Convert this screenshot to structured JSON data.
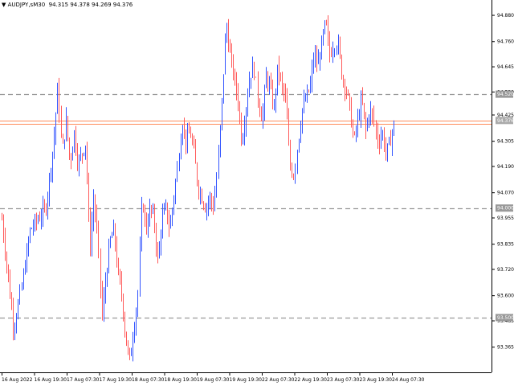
{
  "window": {
    "symbol_menu_icon": "triangle-down-icon",
    "symbol": "AUDJPY,sM30",
    "ohlc": "94.315 94.378 94.269 94.376"
  },
  "colors": {
    "background": "#ffffff",
    "bull": "#3355ff",
    "bear": "#ff5a5a",
    "level_line": "#999999",
    "bid_line": "#ff8c5a",
    "ask_line": "#ff8c5a",
    "level_badge": "#999999",
    "price_badge": "#aaaaaa"
  },
  "chart_data": {
    "type": "candlestick",
    "symbol": "AUDJPY,sM30",
    "current_price": "94.376",
    "y_range": [
      93.25,
      94.95
    ],
    "y_ticks": [
      "94.880",
      "94.760",
      "94.645",
      "94.530",
      "94.425",
      "94.305",
      "94.190",
      "94.070",
      "93.955",
      "93.835",
      "93.720",
      "93.600",
      "93.485",
      "93.365"
    ],
    "x_ticks": [
      "16 Aug 2022",
      "16 Aug 19:30",
      "17 Aug 07:30",
      "17 Aug 19:30",
      "18 Aug 07:30",
      "18 Aug 19:30",
      "19 Aug 07:30",
      "19 Aug 19:30",
      "22 Aug 07:30",
      "22 Aug 19:30",
      "23 Aug 07:30",
      "23 Aug 19:30",
      "24 Aug 07:30"
    ],
    "horizontal_levels": [
      {
        "price": 94.52,
        "label": "94.520"
      },
      {
        "price": 94.0,
        "label": "94.000"
      },
      {
        "price": 93.5,
        "label": "93.500"
      }
    ],
    "price_lines": [
      {
        "price": 94.4,
        "label": "94.376"
      },
      {
        "price": 94.383,
        "label": ""
      }
    ],
    "path": [
      [
        0,
        93.95
      ],
      [
        3,
        93.45
      ],
      [
        5,
        93.65
      ],
      [
        7,
        93.9
      ],
      [
        9,
        93.95
      ],
      [
        11,
        94.0
      ],
      [
        13,
        94.3
      ],
      [
        14,
        94.55
      ],
      [
        15,
        94.25
      ],
      [
        16,
        94.4
      ],
      [
        17,
        94.2
      ],
      [
        18,
        94.35
      ],
      [
        19,
        94.2
      ],
      [
        20,
        94.25
      ],
      [
        21,
        94.3
      ],
      [
        22,
        93.8
      ],
      [
        23,
        94.05
      ],
      [
        24,
        93.85
      ],
      [
        25,
        93.5
      ],
      [
        26,
        93.7
      ],
      [
        27,
        93.85
      ],
      [
        28,
        93.9
      ],
      [
        29,
        93.7
      ],
      [
        30,
        93.6
      ],
      [
        31,
        93.4
      ],
      [
        32,
        93.3
      ],
      [
        33,
        93.45
      ],
      [
        34,
        93.6
      ],
      [
        35,
        94.05
      ],
      [
        36,
        93.9
      ],
      [
        37,
        94.0
      ],
      [
        38,
        93.95
      ],
      [
        39,
        93.75
      ],
      [
        40,
        93.95
      ],
      [
        41,
        94.0
      ],
      [
        42,
        93.9
      ],
      [
        43,
        94.05
      ],
      [
        44,
        94.2
      ],
      [
        45,
        94.4
      ],
      [
        46,
        94.3
      ],
      [
        47,
        94.35
      ],
      [
        48,
        94.25
      ],
      [
        49,
        94.1
      ],
      [
        50,
        94.05
      ],
      [
        51,
        94.0
      ],
      [
        52,
        94.05
      ],
      [
        53,
        94.0
      ],
      [
        54,
        94.2
      ],
      [
        55,
        94.5
      ],
      [
        56,
        94.85
      ],
      [
        57,
        94.7
      ],
      [
        58,
        94.6
      ],
      [
        59,
        94.5
      ],
      [
        60,
        94.3
      ],
      [
        61,
        94.45
      ],
      [
        62,
        94.6
      ],
      [
        63,
        94.65
      ],
      [
        64,
        94.5
      ],
      [
        65,
        94.4
      ],
      [
        66,
        94.6
      ],
      [
        67,
        94.55
      ],
      [
        68,
        94.45
      ],
      [
        69,
        94.65
      ],
      [
        70,
        94.55
      ],
      [
        71,
        94.5
      ],
      [
        72,
        94.2
      ],
      [
        73,
        94.15
      ],
      [
        74,
        94.3
      ],
      [
        75,
        94.45
      ],
      [
        76,
        94.5
      ],
      [
        77,
        94.55
      ],
      [
        78,
        94.7
      ],
      [
        79,
        94.65
      ],
      [
        80,
        94.75
      ],
      [
        81,
        94.85
      ],
      [
        82,
        94.7
      ],
      [
        83,
        94.75
      ],
      [
        84,
        94.75
      ],
      [
        85,
        94.6
      ],
      [
        86,
        94.55
      ],
      [
        87,
        94.45
      ],
      [
        88,
        94.3
      ],
      [
        89,
        94.4
      ],
      [
        90,
        94.5
      ],
      [
        91,
        94.35
      ],
      [
        92,
        94.45
      ],
      [
        93,
        94.4
      ],
      [
        94,
        94.3
      ],
      [
        95,
        94.35
      ],
      [
        96,
        94.25
      ],
      [
        97,
        94.3
      ],
      [
        98,
        94.38
      ]
    ]
  }
}
